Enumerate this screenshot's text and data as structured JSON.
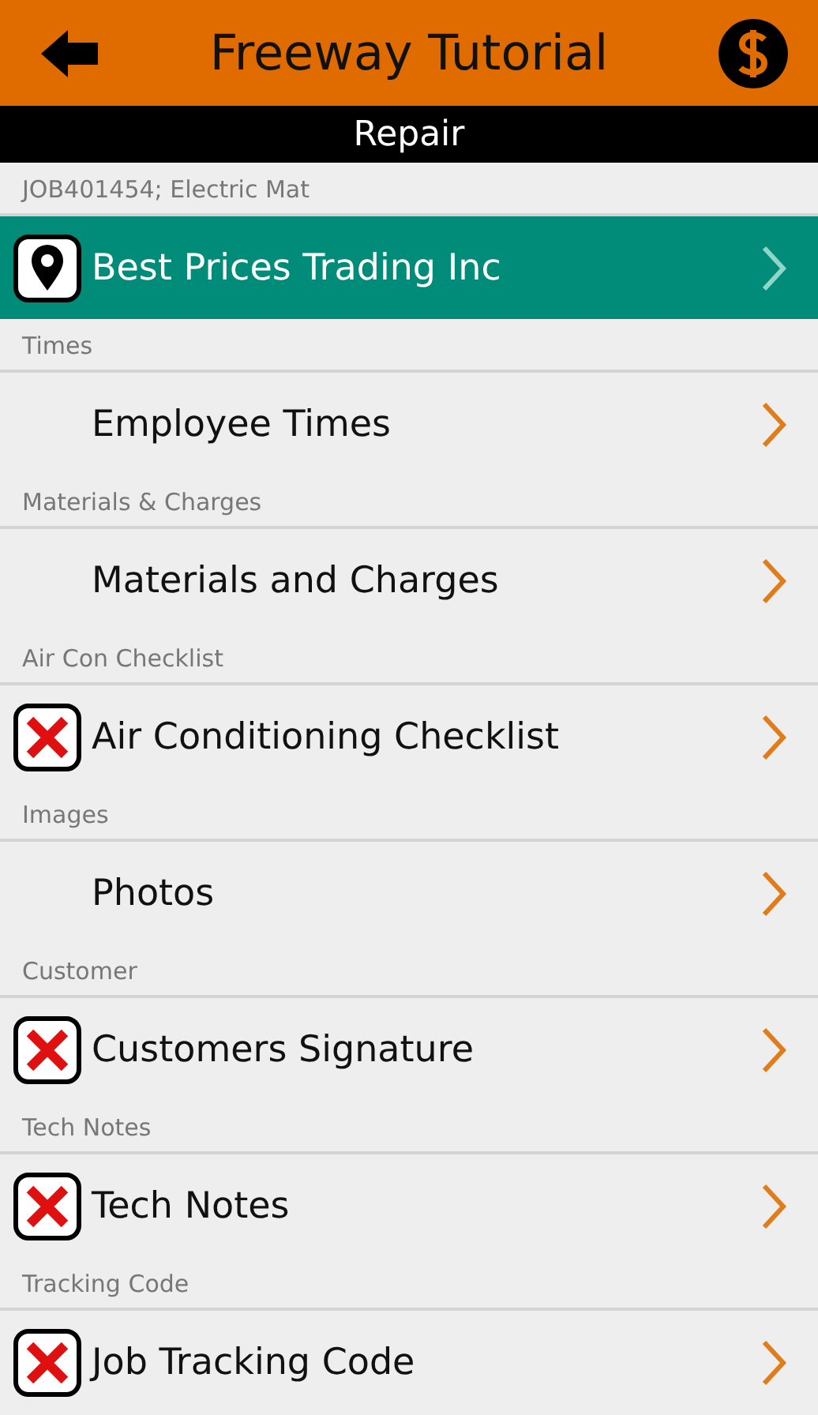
{
  "header": {
    "title": "Freeway Tutorial"
  },
  "subheader": {
    "title": "Repair"
  },
  "sections": [
    {
      "label": "JOB401454; Electric Mat",
      "item": {
        "label": "Best Prices Trading Inc",
        "kind": "location",
        "selected": true
      }
    },
    {
      "label": "Times",
      "item": {
        "label": "Employee Times",
        "kind": "plain",
        "selected": false
      }
    },
    {
      "label": "Materials & Charges",
      "item": {
        "label": "Materials and Charges",
        "kind": "plain",
        "selected": false
      }
    },
    {
      "label": "Air Con Checklist",
      "item": {
        "label": "Air Conditioning Checklist",
        "kind": "incomplete",
        "selected": false
      }
    },
    {
      "label": "Images",
      "item": {
        "label": "Photos",
        "kind": "plain",
        "selected": false
      }
    },
    {
      "label": "Customer",
      "item": {
        "label": "Customers Signature",
        "kind": "incomplete",
        "selected": false
      }
    },
    {
      "label": "Tech Notes",
      "item": {
        "label": "Tech Notes",
        "kind": "incomplete",
        "selected": false
      }
    },
    {
      "label": "Tracking Code",
      "item": {
        "label": "Job Tracking Code",
        "kind": "incomplete",
        "selected": false
      }
    }
  ]
}
